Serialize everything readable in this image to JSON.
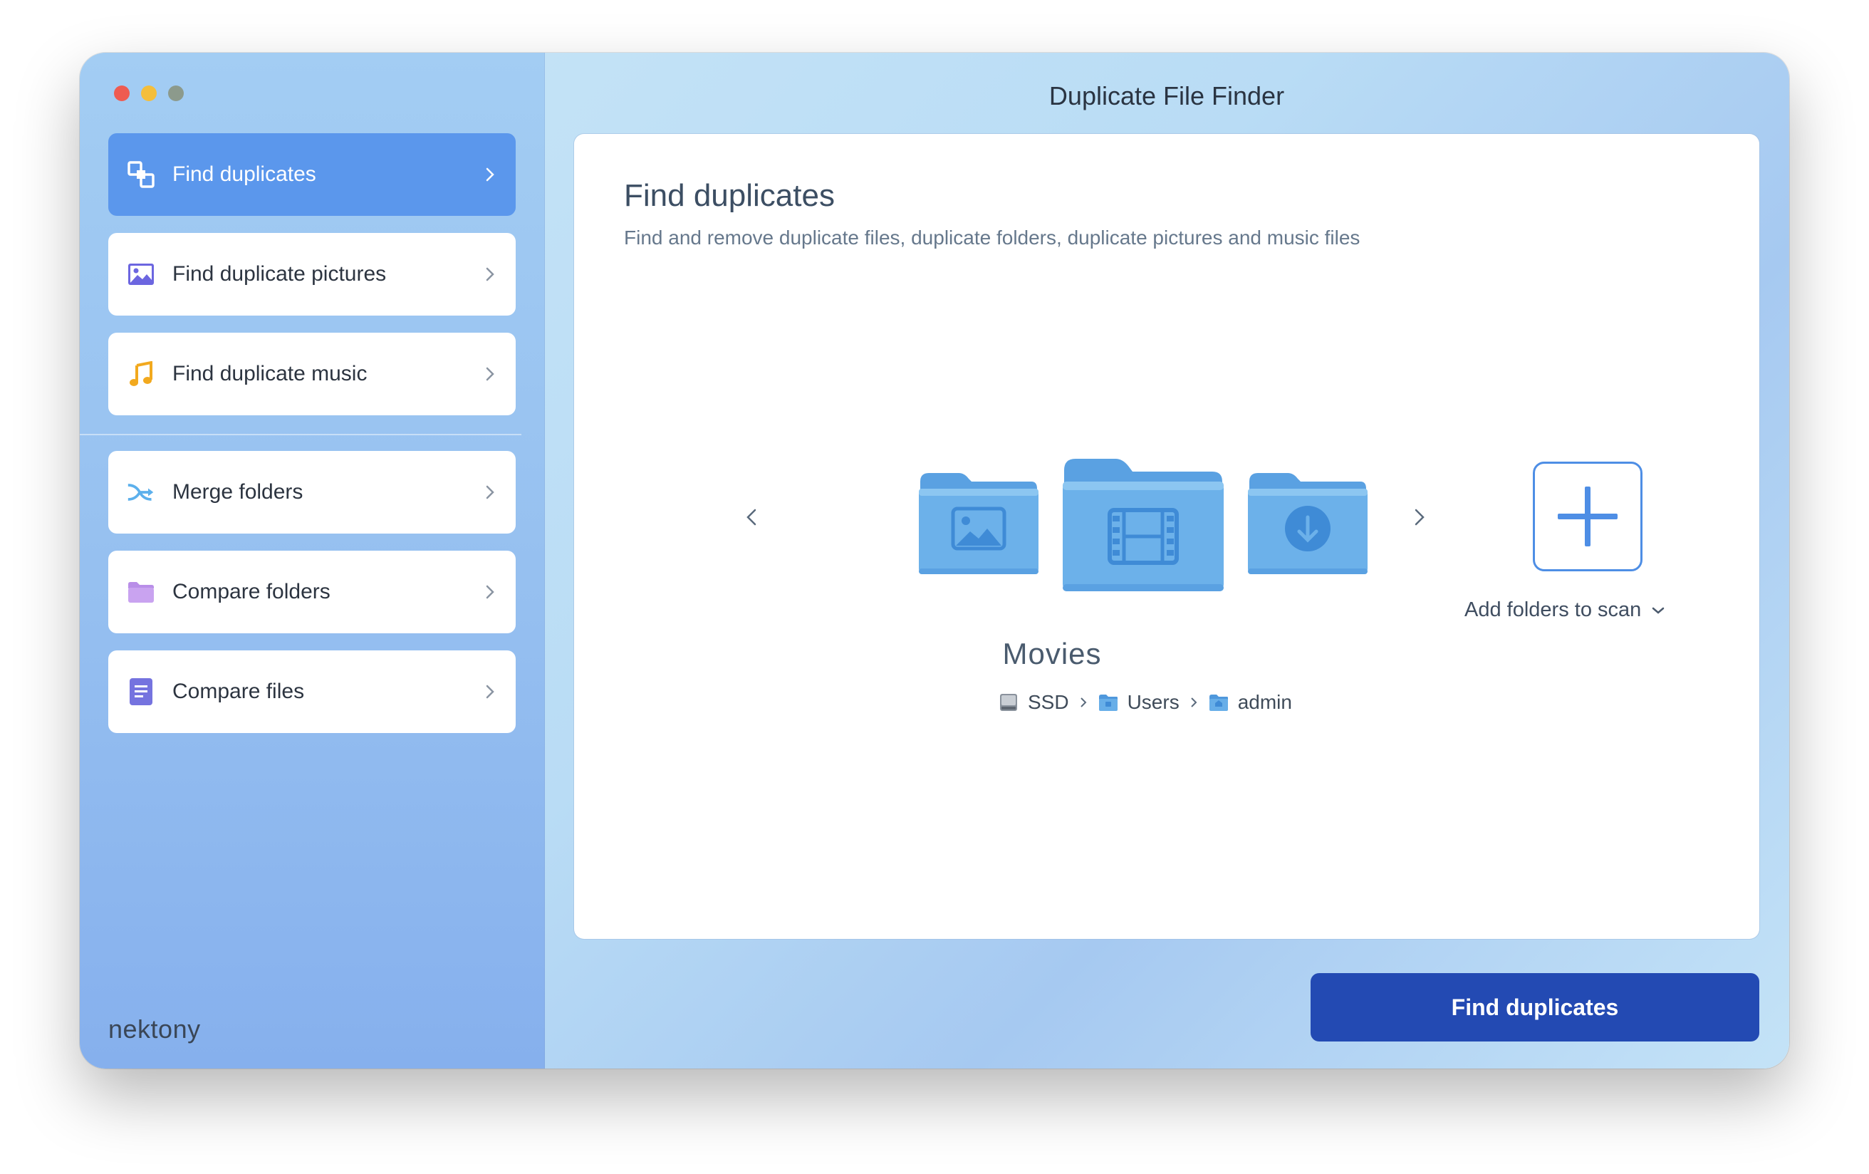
{
  "window": {
    "title": "Duplicate File Finder"
  },
  "sidebar": {
    "items": [
      {
        "label": "Find duplicates",
        "icon": "duplicate-squares-icon",
        "active": true
      },
      {
        "label": "Find duplicate pictures",
        "icon": "picture-icon"
      },
      {
        "label": "Find duplicate music",
        "icon": "music-note-icon"
      },
      {
        "label": "Merge folders",
        "icon": "merge-arrow-icon"
      },
      {
        "label": "Compare folders",
        "icon": "folder-icon"
      },
      {
        "label": "Compare files",
        "icon": "document-icon"
      }
    ],
    "logo": "nektony"
  },
  "panel": {
    "title": "Find duplicates",
    "subtitle": "Find and remove duplicate files, duplicate folders, duplicate pictures and music files",
    "carousel": {
      "folders": [
        "pictures-folder-icon",
        "movies-folder-icon",
        "downloads-folder-icon"
      ],
      "selected_name": "Movies"
    },
    "path": [
      "SSD",
      "Users",
      "admin"
    ],
    "add_label": "Add folders to scan"
  },
  "action": {
    "label": "Find duplicates"
  },
  "colors": {
    "accent": "#5b97ec",
    "primary_button": "#234ab3",
    "folder": "#7cbcec"
  }
}
